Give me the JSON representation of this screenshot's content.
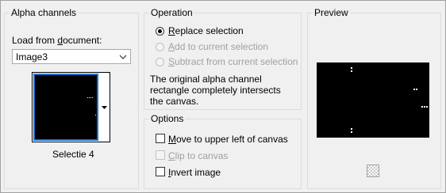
{
  "alpha_channels": {
    "title": "Alpha channels",
    "load_label_pre": "Load from ",
    "load_label_u": "d",
    "load_label_post": "ocument:",
    "document_value": "Image3",
    "thumbnail_caption": "Selectie 4"
  },
  "operation": {
    "title": "Operation",
    "options": [
      {
        "u": "R",
        "rest": "eplace selection",
        "checked": true,
        "enabled": true
      },
      {
        "u": "A",
        "rest": "dd to current selection",
        "checked": false,
        "enabled": false
      },
      {
        "u": "S",
        "rest": "ubtract from current selection",
        "checked": false,
        "enabled": false
      }
    ],
    "description": "The original alpha channel rectangle completely intersects the canvas."
  },
  "options": {
    "title": "Options",
    "items": [
      {
        "u": "M",
        "rest": "ove to upper left of canvas",
        "checked": false,
        "enabled": true
      },
      {
        "u": "C",
        "rest": "lip to canvas",
        "checked": false,
        "enabled": false
      },
      {
        "u": "I",
        "rest": "nvert image",
        "checked": false,
        "enabled": true
      }
    ]
  },
  "preview": {
    "title": "Preview"
  }
}
